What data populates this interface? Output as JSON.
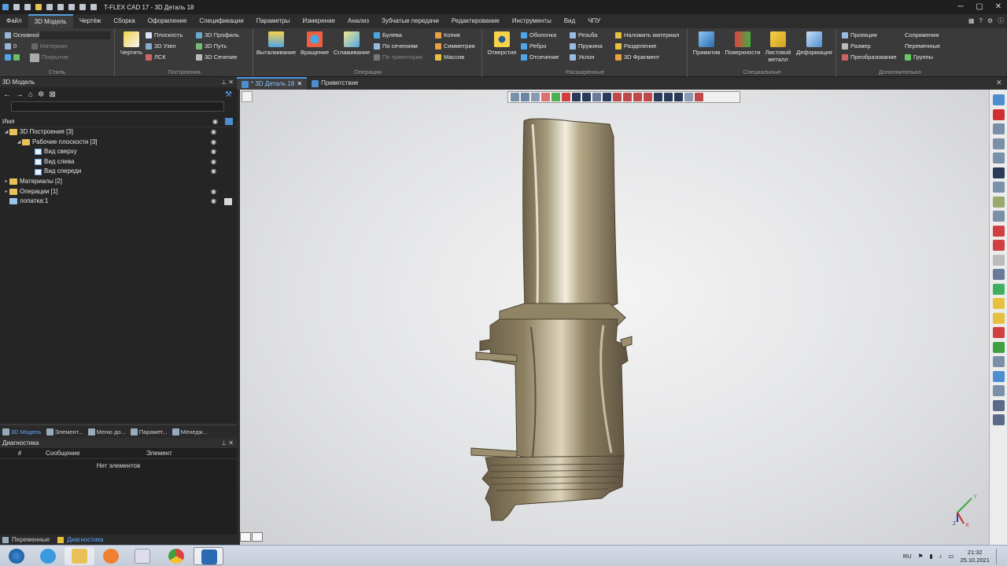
{
  "window": {
    "title": "T-FLEX CAD 17 - 3D Деталь 18"
  },
  "menu": {
    "items": [
      "Файл",
      "3D Модель",
      "Чертёж",
      "Сборка",
      "Оформление",
      "Спецификации",
      "Параметры",
      "Измерение",
      "Анализ",
      "Зубчатые передачи",
      "Редактирование",
      "Инструменты",
      "Вид",
      "ЧПУ"
    ],
    "active": "3D Модель"
  },
  "ribbon": {
    "style": {
      "label": "Стиль",
      "layer": "Основной",
      "level": "0",
      "material": "Материал",
      "coating": "Покрытие"
    },
    "constructions": {
      "label": "Построения",
      "draw": "Чертить",
      "plane": "Плоскость",
      "node3d": "3D Узел",
      "lcs": "ЛСК",
      "profile3d": "3D Профиль",
      "path3d": "3D Путь",
      "section3d": "3D Сечение"
    },
    "operations": {
      "label": "Операции",
      "extrude": "Выталкивание",
      "rotate": "Вращение",
      "smooth": "Сглаживание",
      "boolean": "Булева",
      "by_sections": "По сечениям",
      "by_path": "По траектории",
      "copy": "Копия",
      "symmetry": "Симметрия",
      "array": "Массив"
    },
    "extended": {
      "label": "Расширенные",
      "hole": "Отверстие",
      "shell": "Оболочка",
      "rib": "Ребро",
      "cut": "Отсечение",
      "thread": "Резьба",
      "spring": "Пружина",
      "slope": "Уклон",
      "apply_material": "Наложить материал",
      "split": "Разделение",
      "fragment3d": "3D Фрагмент"
    },
    "special": {
      "label": "Специальные",
      "primitive": "Примитив",
      "surfaces": "Поверхности",
      "sheet_metal": "Листовой металл",
      "deformation": "Деформация"
    },
    "additional": {
      "label": "Дополнительно",
      "projection": "Проекция",
      "size": "Размер",
      "transform": "Преобразование",
      "mates": "Сопряжения",
      "variables": "Переменные",
      "groups": "Группы"
    }
  },
  "model_panel": {
    "title": "3D Модель",
    "column_name": "Имя",
    "tree": [
      {
        "label": "3D Построения [3]",
        "level": 0,
        "kind": "folder",
        "twist": "◢",
        "eye": true,
        "extra": false
      },
      {
        "label": "Рабочие плоскости [3]",
        "level": 1,
        "kind": "folder",
        "twist": "◢",
        "eye": true,
        "extra": false
      },
      {
        "label": "Вид сверху",
        "level": 2,
        "kind": "plane",
        "twist": "",
        "eye": true,
        "extra": false
      },
      {
        "label": "Вид слева",
        "level": 2,
        "kind": "plane",
        "twist": "",
        "eye": true,
        "extra": false
      },
      {
        "label": "Вид спереди",
        "level": 2,
        "kind": "plane",
        "twist": "",
        "eye": true,
        "extra": false
      },
      {
        "label": "Материалы [2]",
        "level": 0,
        "kind": "folder",
        "twist": "▸",
        "eye": false,
        "extra": false
      },
      {
        "label": "Операции [1]",
        "level": 0,
        "kind": "folder",
        "twist": "▸",
        "eye": true,
        "extra": false
      },
      {
        "label": "лопатка:1",
        "level": 0,
        "kind": "body",
        "twist": "",
        "eye": true,
        "extra": true
      }
    ]
  },
  "panel_tabs": [
    {
      "label": "3D Модель",
      "active": true
    },
    {
      "label": "Элемент...",
      "active": false
    },
    {
      "label": "Меню до...",
      "active": false
    },
    {
      "label": "Парамет...",
      "active": false
    },
    {
      "label": "Менедж...",
      "active": false
    }
  ],
  "diagnostics": {
    "title": "Диагностика",
    "col_num": "#",
    "col_message": "Сообщение",
    "col_element": "Элемент",
    "empty": "Нет элементов"
  },
  "bottom_tabs": {
    "variables": "Переменные",
    "diagnostics": "Диагностика"
  },
  "doc_tabs": [
    {
      "label": "* 3D Деталь 18",
      "active": true,
      "close": "✕"
    },
    {
      "label": "Приветствие",
      "active": false,
      "close": ""
    }
  ],
  "axes": {
    "x": "X",
    "y": "Y",
    "z": "Z"
  },
  "tray": {
    "lang": "RU",
    "time": "21:32",
    "date": "25.10.2021"
  },
  "colors": {
    "accent": "#4d98e6",
    "part": "#8d8062",
    "viewport_bg": "#e4e5e7"
  }
}
